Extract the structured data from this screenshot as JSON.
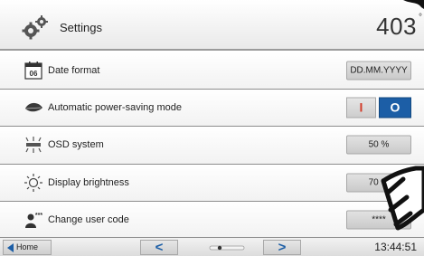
{
  "header": {
    "title": "Settings",
    "temperature": "403",
    "temperature_unit": "°",
    "icon": "gears-icon"
  },
  "rows": [
    {
      "label": "Date format",
      "value": "DD.MM.YYYY",
      "icon": "calendar-icon",
      "calendar_number": "06"
    },
    {
      "label": "Automatic power-saving mode",
      "toggle_on": "I",
      "toggle_off": "O",
      "selected": "O",
      "icon": "leaf-icon"
    },
    {
      "label": "OSD system",
      "value": "50 %",
      "icon": "osd-icon"
    },
    {
      "label": "Display brightness",
      "value": "70 %",
      "icon": "sun-icon"
    },
    {
      "label": "Change user code",
      "value": "****",
      "icon": "user-code-icon"
    }
  ],
  "footer": {
    "home_label": "Home",
    "prev": "<",
    "next": ">",
    "page_current": 1,
    "page_total": 2,
    "time": "13:44:51"
  },
  "colors": {
    "accent": "#1c5ea6",
    "toggle_on": "#d23c2a",
    "divider": "#8d8d8d"
  }
}
